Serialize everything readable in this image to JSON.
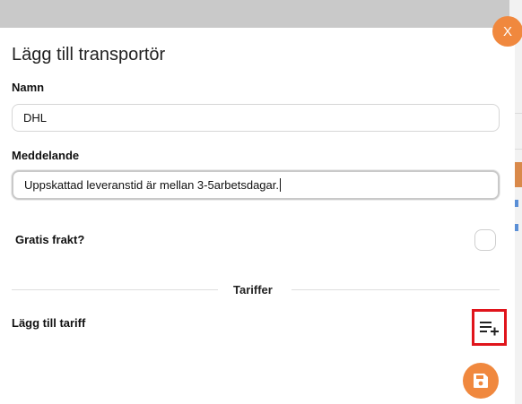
{
  "modal": {
    "close_label": "X",
    "title": "Lägg till transportör"
  },
  "form": {
    "name_label": "Namn",
    "name_value": "DHL",
    "message_label": "Meddelande",
    "message_value": "Uppskattad leveranstid är mellan 3-5arbetsdagar.",
    "free_shipping_label": "Gratis frakt?",
    "free_shipping_checked": false
  },
  "tariffs": {
    "section_title": "Tariffer",
    "add_label": "Lägg till tariff"
  },
  "icons": {
    "add_tariff": "playlist-add-icon",
    "save": "save-icon"
  },
  "colors": {
    "accent": "#f0883e",
    "highlight": "#e0141b"
  }
}
